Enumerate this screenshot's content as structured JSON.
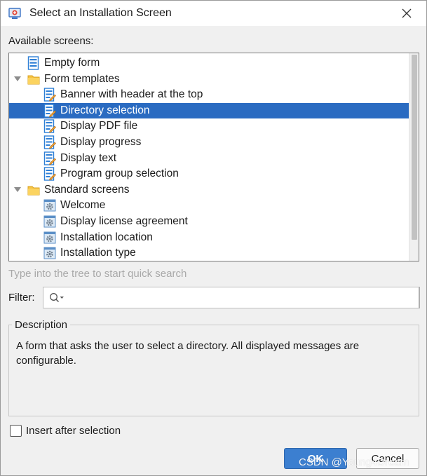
{
  "window": {
    "title": "Select an Installation Screen",
    "icon": "installer-app-icon"
  },
  "screens_label": "Available screens:",
  "tree": {
    "items": [
      {
        "label": "Empty form",
        "icon": "form-icon",
        "level": 1
      },
      {
        "label": "Form templates",
        "icon": "folder-icon",
        "level": 0,
        "expanded": true
      },
      {
        "label": "Banner with header at the top",
        "icon": "form-template-icon",
        "level": 2
      },
      {
        "label": "Directory selection",
        "icon": "form-template-icon",
        "level": 2,
        "selected": true
      },
      {
        "label": "Display PDF file",
        "icon": "form-template-icon",
        "level": 2
      },
      {
        "label": "Display progress",
        "icon": "form-template-icon",
        "level": 2
      },
      {
        "label": "Display text",
        "icon": "form-template-icon",
        "level": 2
      },
      {
        "label": "Program group selection",
        "icon": "form-template-icon",
        "level": 2
      },
      {
        "label": "Standard screens",
        "icon": "folder-icon",
        "level": 0,
        "expanded": true
      },
      {
        "label": "Welcome",
        "icon": "gear-screen-icon",
        "level": 2
      },
      {
        "label": "Display license agreement",
        "icon": "gear-screen-icon",
        "level": 2
      },
      {
        "label": "Installation location",
        "icon": "gear-screen-icon",
        "level": 2
      },
      {
        "label": "Installation type",
        "icon": "gear-screen-icon",
        "level": 2
      }
    ]
  },
  "quick_search_hint": "Type into the tree to start quick search",
  "filter": {
    "label": "Filter:",
    "value": "",
    "placeholder": ""
  },
  "description": {
    "legend": "Description",
    "text": "A form that asks the user to select a directory. All displayed messages are configurable."
  },
  "insert_after": {
    "label": "Insert after selection",
    "checked": false
  },
  "buttons": {
    "ok": "OK",
    "cancel": "Cancel"
  },
  "watermark": "CSDN @Young4Dream",
  "colors": {
    "selection": "#2a6bc1",
    "ok_button": "#3c7fd0",
    "folder": "#f6c343",
    "dialog_bg": "#f0f0f0"
  }
}
